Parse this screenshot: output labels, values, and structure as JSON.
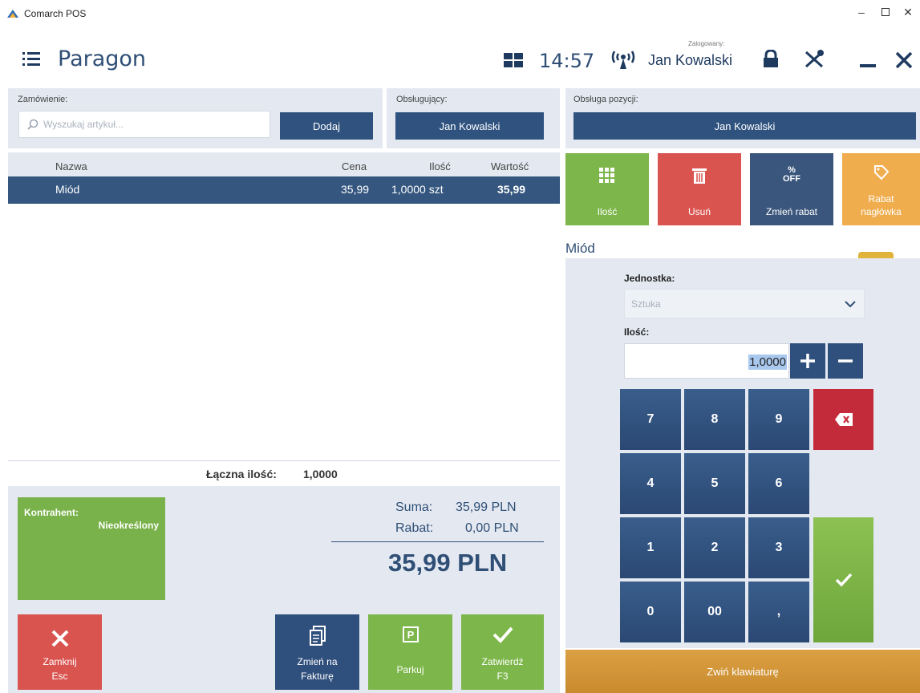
{
  "window": {
    "title": "Comarch POS",
    "controls": [
      "minimize",
      "maximize",
      "close"
    ]
  },
  "header": {
    "title": "Paragon",
    "time": "14:57",
    "logged_in_caption": "Zalogowany:",
    "user": "Jan Kowalski",
    "icons": [
      "grid-icon",
      "wifi-icon",
      "lock-icon",
      "tools-icon",
      "minimize-icon",
      "close-icon"
    ]
  },
  "order": {
    "label": "Zamówienie:",
    "search_placeholder": "Wyszukaj artykuł...",
    "add_button": "Dodaj"
  },
  "served_by": {
    "label": "Obsługujący:",
    "value": "Jan Kowalski"
  },
  "item_service": {
    "label": "Obsługa pozycji:",
    "value": "Jan Kowalski"
  },
  "table": {
    "columns": [
      "Nazwa",
      "Cena",
      "Ilość",
      "Wartość"
    ],
    "rows": [
      {
        "name": "Miód",
        "price": "35,99",
        "qty": "1,0000 szt",
        "value": "35,99"
      }
    ],
    "total_qty_label": "Łączna ilość:",
    "total_qty": "1,0000"
  },
  "actions": {
    "qty": "Ilość",
    "delete": "Usuń",
    "change_discount": "Zmień rabat",
    "discount_header_line1": "Rabat",
    "discount_header_line2": "nagłówka",
    "percent_off_line1": "%",
    "percent_off_line2": "OFF"
  },
  "product": {
    "name": "Miód",
    "unit_label": "Jednostka:",
    "unit_value": "Sztuka",
    "qty_label": "Ilość:",
    "qty_value": "1,0000"
  },
  "keypad": {
    "keys": [
      "7",
      "8",
      "9",
      "4",
      "5",
      "6",
      "1",
      "2",
      "3",
      "0",
      "00",
      ","
    ],
    "collapse": "Zwiń klawiaturę"
  },
  "customer": {
    "label": "Kontrahent:",
    "value": "Nieokreślony"
  },
  "summary": {
    "sum_label": "Suma:",
    "sum_value": "35,99 PLN",
    "discount_label": "Rabat:",
    "discount_value": "0,00 PLN",
    "total": "35,99 PLN"
  },
  "bottom_buttons": {
    "close_line1": "Zamknij",
    "close_line2": "Esc",
    "invoice_line1": "Zmień na",
    "invoice_line2": "Fakturę",
    "park": "Parkuj",
    "confirm_line1": "Zatwierdź",
    "confirm_line2": "F3"
  },
  "colors": {
    "navy": "#2f527f",
    "green": "#7db64a",
    "red": "#d9534f",
    "orange": "#f0ad4e",
    "panel": "#e4e9f1"
  }
}
